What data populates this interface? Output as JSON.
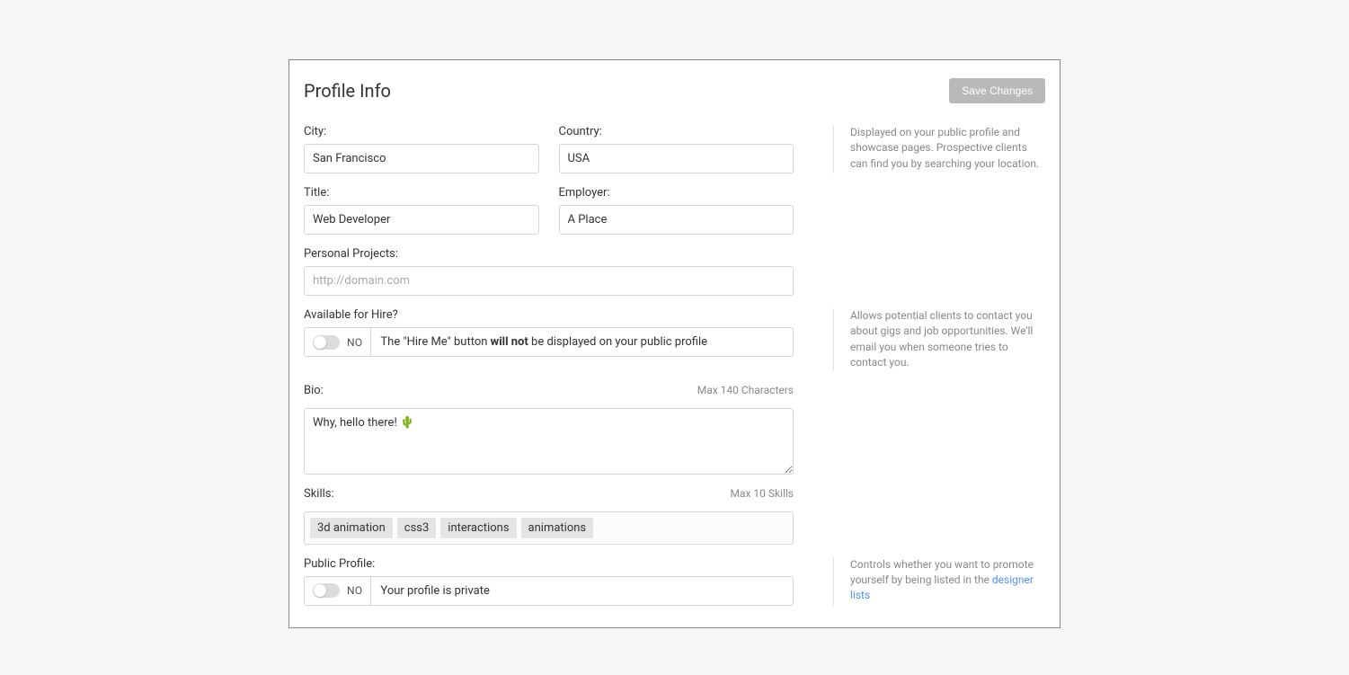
{
  "header": {
    "title": "Profile Info",
    "save_label": "Save Changes"
  },
  "labels": {
    "city": "City:",
    "country": "Country:",
    "title": "Title:",
    "employer": "Employer:",
    "projects": "Personal Projects:",
    "hire": "Available for Hire?",
    "bio": "Bio:",
    "bio_hint": "Max 140 Characters",
    "skills": "Skills:",
    "skills_hint": "Max 10 Skills",
    "public": "Public Profile:"
  },
  "values": {
    "city": "San Francisco",
    "country": "USA",
    "title": "Web Developer",
    "employer": "A Place",
    "projects": "",
    "projects_placeholder": "http://domain.com",
    "bio": "Why, hello there! 🌵"
  },
  "toggles": {
    "hire_state": "NO",
    "hire_desc_pre": "The \"Hire Me\" button ",
    "hire_desc_strong": "will not",
    "hire_desc_post": " be displayed on your public profile",
    "public_state": "NO",
    "public_desc": "Your profile is private"
  },
  "skills": [
    "3d animation",
    "css3",
    "interactions",
    "animations"
  ],
  "side": {
    "location": "Displayed on your public profile and showcase pages. Prospective clients can find you by searching your location.",
    "hire": "Allows potential clients to contact you about gigs and job opportunities. We'll email you when someone tries to contact you.",
    "public_pre": "Controls whether you want to promote yourself by being listed in the ",
    "public_link": "designer lists"
  }
}
